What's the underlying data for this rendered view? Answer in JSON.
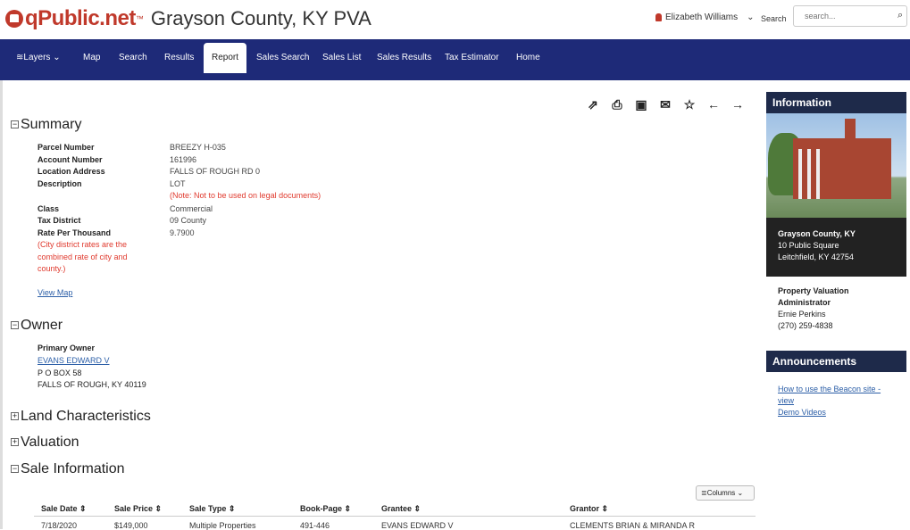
{
  "header": {
    "brand": "qPublic.net",
    "tm": "™",
    "county_title": "Grayson County, KY PVA",
    "user_name": "Elizabeth Williams",
    "search_label": "Search",
    "search_placeholder": "search..."
  },
  "nav": [
    "Layers",
    "Map",
    "Search",
    "Results",
    "Report",
    "Sales Search",
    "Sales List",
    "Sales Results",
    "Tax Estimator",
    "Home"
  ],
  "nav_active": "Report",
  "summary": {
    "title": "Summary",
    "rows": [
      {
        "label": "Parcel Number",
        "value": "BREEZY H-035"
      },
      {
        "label": "Account Number",
        "value": "161996"
      },
      {
        "label": "Location Address",
        "value": "FALLS OF ROUGH RD 0"
      },
      {
        "label": "Description",
        "value": "LOT"
      },
      {
        "label": "Class",
        "value": "Commercial"
      },
      {
        "label": "Tax District",
        "value": "09 County"
      },
      {
        "label": "Rate Per Thousand",
        "value": "9.7900"
      }
    ],
    "description_note": "(Note: Not to be used on legal documents)",
    "rate_note": [
      "(City district rates are the",
      "combined rate of city and",
      "county.)"
    ],
    "view_map": "View Map"
  },
  "owner": {
    "title": "Owner",
    "label": "Primary Owner",
    "name": "EVANS EDWARD V",
    "line1": "P O BOX 58",
    "line2": "FALLS OF ROUGH, KY 40119"
  },
  "sections": {
    "land": "Land Characteristics",
    "valuation": "Valuation",
    "sale": "Sale Information"
  },
  "sale_table": {
    "columns_button": "Columns",
    "headers": [
      "Sale Date",
      "Sale Price",
      "Sale Type",
      "Book-Page",
      "Grantee",
      "Grantor"
    ],
    "rows": [
      [
        "7/18/2020",
        "$149,000",
        "Multiple Properties",
        "491-446",
        "EVANS EDWARD V",
        "CLEMENTS BRIAN & MIRANDA R"
      ]
    ]
  },
  "sidebar": {
    "info_title": "Information",
    "county": "Grayson County, KY",
    "street": "10 Public Square",
    "city": "Leitchfield, KY 42754",
    "pva_title_1": "Property Valuation",
    "pva_title_2": "Administrator",
    "pva_name": "Ernie Perkins",
    "pva_phone": "(270) 259-4838",
    "ann_title": "Announcements",
    "ann_link_1": "How to use the Beacon site - view",
    "ann_link_2": "Demo Videos"
  },
  "colors": {
    "nav_bg": "#1e2a78",
    "brand_red": "#c0392b",
    "note_red": "#e03a2e",
    "panel_bg": "#1e2a4a"
  }
}
